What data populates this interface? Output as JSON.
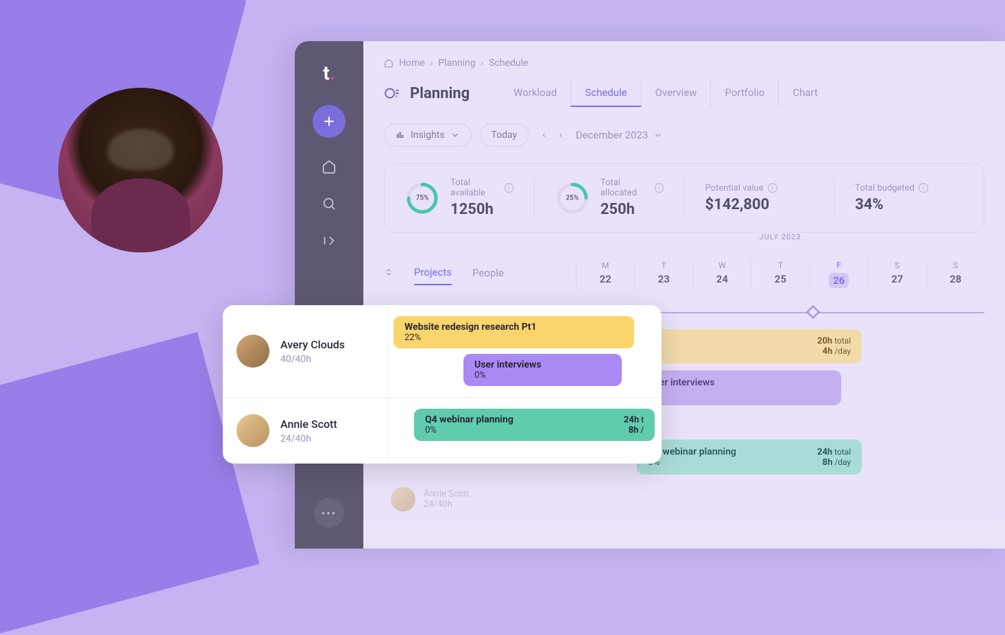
{
  "logo": "t",
  "breadcrumbs": [
    "Home",
    "Planning",
    "Schedule"
  ],
  "page_title": "Planning",
  "tabs": [
    "Workload",
    "Schedule",
    "Overview",
    "Portfolio",
    "Chart"
  ],
  "active_tab": "Schedule",
  "controls": {
    "insights_label": "Insights",
    "today_label": "Today",
    "period": "December 2023"
  },
  "metrics": [
    {
      "label": "Total available",
      "value": "1250h",
      "pct": "75%",
      "pct_num": 75
    },
    {
      "label": "Total allocated",
      "value": "250h",
      "pct": "25%",
      "pct_num": 25
    },
    {
      "label": "Potential value",
      "value": "$142,800"
    },
    {
      "label": "Total budgeted",
      "value": "34%"
    }
  ],
  "timeline": {
    "month_label": "JULY 2023",
    "subtabs": [
      "Projects",
      "People"
    ],
    "active_subtab": "Projects",
    "days": [
      {
        "letter": "M",
        "num": "22"
      },
      {
        "letter": "T",
        "num": "23"
      },
      {
        "letter": "W",
        "num": "24"
      },
      {
        "letter": "T",
        "num": "25"
      },
      {
        "letter": "F",
        "num": "26",
        "highlight": true
      },
      {
        "letter": "S",
        "num": "27"
      },
      {
        "letter": "S",
        "num": "28"
      }
    ]
  },
  "schedule_bars": [
    {
      "title": "n research Pt1",
      "pct": "",
      "total": "20h",
      "total_suffix": "total",
      "day": "4h",
      "day_suffix": "/day",
      "color": "yellow"
    },
    {
      "title": "User interviews",
      "pct": "0%",
      "color": "purple"
    },
    {
      "title": "Q4 webinar planning",
      "pct": "0%",
      "total": "24h",
      "total_suffix": "total",
      "day": "8h",
      "day_suffix": "/day",
      "color": "teal"
    }
  ],
  "overlay": {
    "people": [
      {
        "name": "Avery Clouds",
        "hours": "40/40h",
        "bars": [
          {
            "title": "Website redesign research Pt1",
            "pct": "22%",
            "color": "yellow"
          },
          {
            "title": "User interviews",
            "pct": "0%",
            "color": "purple"
          }
        ]
      },
      {
        "name": "Annie Scott",
        "hours": "24/40h",
        "bars": [
          {
            "title": "Q4 webinar planning",
            "pct": "0%",
            "total": "24h",
            "day": "8h",
            "color": "teal"
          }
        ]
      }
    ]
  },
  "ghost": {
    "name": "Annie Scott",
    "hours": "24/40h"
  }
}
